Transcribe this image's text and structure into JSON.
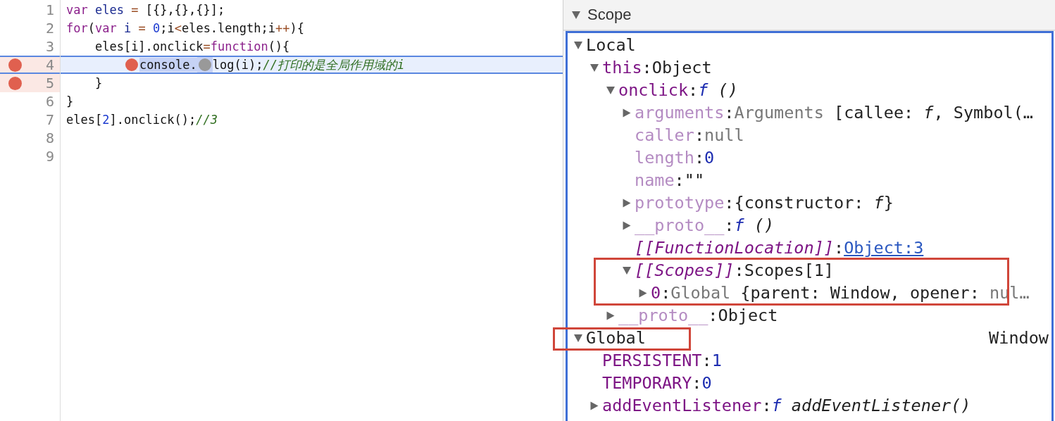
{
  "editor": {
    "lines": [
      {
        "number": "1",
        "breakpoint": false,
        "paused": false,
        "tokens": [
          {
            "text": "var",
            "kind": "kw"
          },
          {
            "text": " eles",
            "kind": "def"
          },
          {
            "text": " =",
            "kind": "op"
          },
          {
            "text": " [{},{},{}];",
            "kind": "plain"
          }
        ]
      },
      {
        "number": "2",
        "breakpoint": false,
        "paused": false,
        "tokens": [
          {
            "text": "for",
            "kind": "kw"
          },
          {
            "text": "(",
            "kind": "plain"
          },
          {
            "text": "var",
            "kind": "kw"
          },
          {
            "text": " i",
            "kind": "def"
          },
          {
            "text": " =",
            "kind": "op"
          },
          {
            "text": " 0",
            "kind": "num"
          },
          {
            "text": ";i",
            "kind": "plain"
          },
          {
            "text": "<",
            "kind": "op"
          },
          {
            "text": "eles.length;i",
            "kind": "plain"
          },
          {
            "text": "++",
            "kind": "op"
          },
          {
            "text": "){",
            "kind": "plain"
          }
        ]
      },
      {
        "number": "3",
        "breakpoint": false,
        "paused": false,
        "tokens": [
          {
            "text": "    eles[i].onclick",
            "kind": "plain"
          },
          {
            "text": "=",
            "kind": "op"
          },
          {
            "text": "function",
            "kind": "kw"
          },
          {
            "text": "(){",
            "kind": "plain"
          }
        ]
      },
      {
        "number": "4",
        "breakpoint": true,
        "paused": true,
        "tokens": [
          {
            "text": "        console.",
            "kind": "active-stop"
          },
          {
            "text": "log(i);",
            "kind": "inactive-stop"
          },
          {
            "text": "//打印的是全局作用域的i",
            "kind": "comment"
          }
        ]
      },
      {
        "number": "5",
        "breakpoint": true,
        "paused": false,
        "tokens": [
          {
            "text": "    }",
            "kind": "plain"
          }
        ]
      },
      {
        "number": "6",
        "breakpoint": false,
        "paused": false,
        "tokens": [
          {
            "text": "}",
            "kind": "plain"
          }
        ]
      },
      {
        "number": "7",
        "breakpoint": false,
        "paused": false,
        "tokens": [
          {
            "text": "eles[",
            "kind": "plain"
          },
          {
            "text": "2",
            "kind": "num"
          },
          {
            "text": "].onclick();",
            "kind": "plain"
          },
          {
            "text": "//3",
            "kind": "comment"
          }
        ]
      },
      {
        "number": "8",
        "breakpoint": false,
        "paused": false
      },
      {
        "number": "9",
        "breakpoint": false,
        "paused": false
      }
    ]
  },
  "scope": {
    "title": "Scope",
    "expanded": true,
    "tree": [
      {
        "name": "Local",
        "kind": "section",
        "expanded": true,
        "children": [
          {
            "name": "this",
            "kind": "own",
            "separator": ":",
            "expanded": true,
            "value": [
              {
                "text": "Object",
                "kind": "plain"
              }
            ],
            "children": [
              {
                "name": "onclick",
                "kind": "own",
                "separator": ":",
                "expanded": true,
                "value": [
                  {
                    "text": "f",
                    "kind": "fn"
                  },
                  {
                    "text": " ()",
                    "kind": "italic"
                  }
                ],
                "children": [
                  {
                    "name": "arguments",
                    "kind": "dim",
                    "separator": ":",
                    "expanded": false,
                    "value": [
                      {
                        "text": "Arguments",
                        "kind": "gray"
                      },
                      {
                        "text": " [callee: ",
                        "kind": "plain"
                      },
                      {
                        "text": "f",
                        "kind": "italic"
                      },
                      {
                        "text": ", Symbol(…",
                        "kind": "plain"
                      }
                    ]
                  },
                  {
                    "name": "caller",
                    "kind": "dim",
                    "separator": ":",
                    "value": [
                      {
                        "text": "null",
                        "kind": "gray"
                      }
                    ]
                  },
                  {
                    "name": "length",
                    "kind": "dim",
                    "separator": ":",
                    "value": [
                      {
                        "text": "0",
                        "kind": "num"
                      }
                    ]
                  },
                  {
                    "name": "name",
                    "kind": "dim",
                    "separator": ":",
                    "value": [
                      {
                        "text": "\"\"",
                        "kind": "plain"
                      }
                    ]
                  },
                  {
                    "name": "prototype",
                    "kind": "dim",
                    "separator": ":",
                    "expanded": false,
                    "value": [
                      {
                        "text": "{constructor: ",
                        "kind": "plain"
                      },
                      {
                        "text": "f",
                        "kind": "italic"
                      },
                      {
                        "text": "}",
                        "kind": "plain"
                      }
                    ]
                  },
                  {
                    "name": "__proto__",
                    "kind": "dim",
                    "separator": ":",
                    "expanded": false,
                    "value": [
                      {
                        "text": "f",
                        "kind": "fn"
                      },
                      {
                        "text": " ()",
                        "kind": "italic"
                      }
                    ]
                  },
                  {
                    "name": "[[FunctionLocation]]",
                    "kind": "internal",
                    "separator": ":",
                    "value": [
                      {
                        "text": "Object:3",
                        "kind": "link"
                      }
                    ]
                  },
                  {
                    "name": "[[Scopes]]",
                    "kind": "internal",
                    "separator": ":",
                    "expanded": true,
                    "value": [
                      {
                        "text": "Scopes[1]",
                        "kind": "plain"
                      }
                    ],
                    "children": [
                      {
                        "name": "0",
                        "kind": "own",
                        "separator": ":",
                        "expanded": false,
                        "value": [
                          {
                            "text": "Global",
                            "kind": "gray"
                          },
                          {
                            "text": " {parent: Window, opener: ",
                            "kind": "plain"
                          },
                          {
                            "text": "nul…",
                            "kind": "gray"
                          }
                        ]
                      }
                    ]
                  }
                ]
              },
              {
                "name": "__proto__",
                "kind": "dim",
                "separator": ":",
                "expanded": false,
                "value": [
                  {
                    "text": "Object",
                    "kind": "plain"
                  }
                ]
              }
            ]
          }
        ]
      },
      {
        "name": "Global",
        "kind": "section",
        "expanded": true,
        "summary": "Window",
        "children": [
          {
            "name": "PERSISTENT",
            "kind": "own",
            "separator": ":",
            "value": [
              {
                "text": "1",
                "kind": "num"
              }
            ]
          },
          {
            "name": "TEMPORARY",
            "kind": "own",
            "separator": ":",
            "value": [
              {
                "text": "0",
                "kind": "num"
              }
            ]
          },
          {
            "name": "addEventListener",
            "kind": "own",
            "separator": ":",
            "expanded": false,
            "value": [
              {
                "text": "f",
                "kind": "fn"
              },
              {
                "text": " addEventListener()",
                "kind": "italic"
              }
            ]
          }
        ]
      }
    ]
  }
}
